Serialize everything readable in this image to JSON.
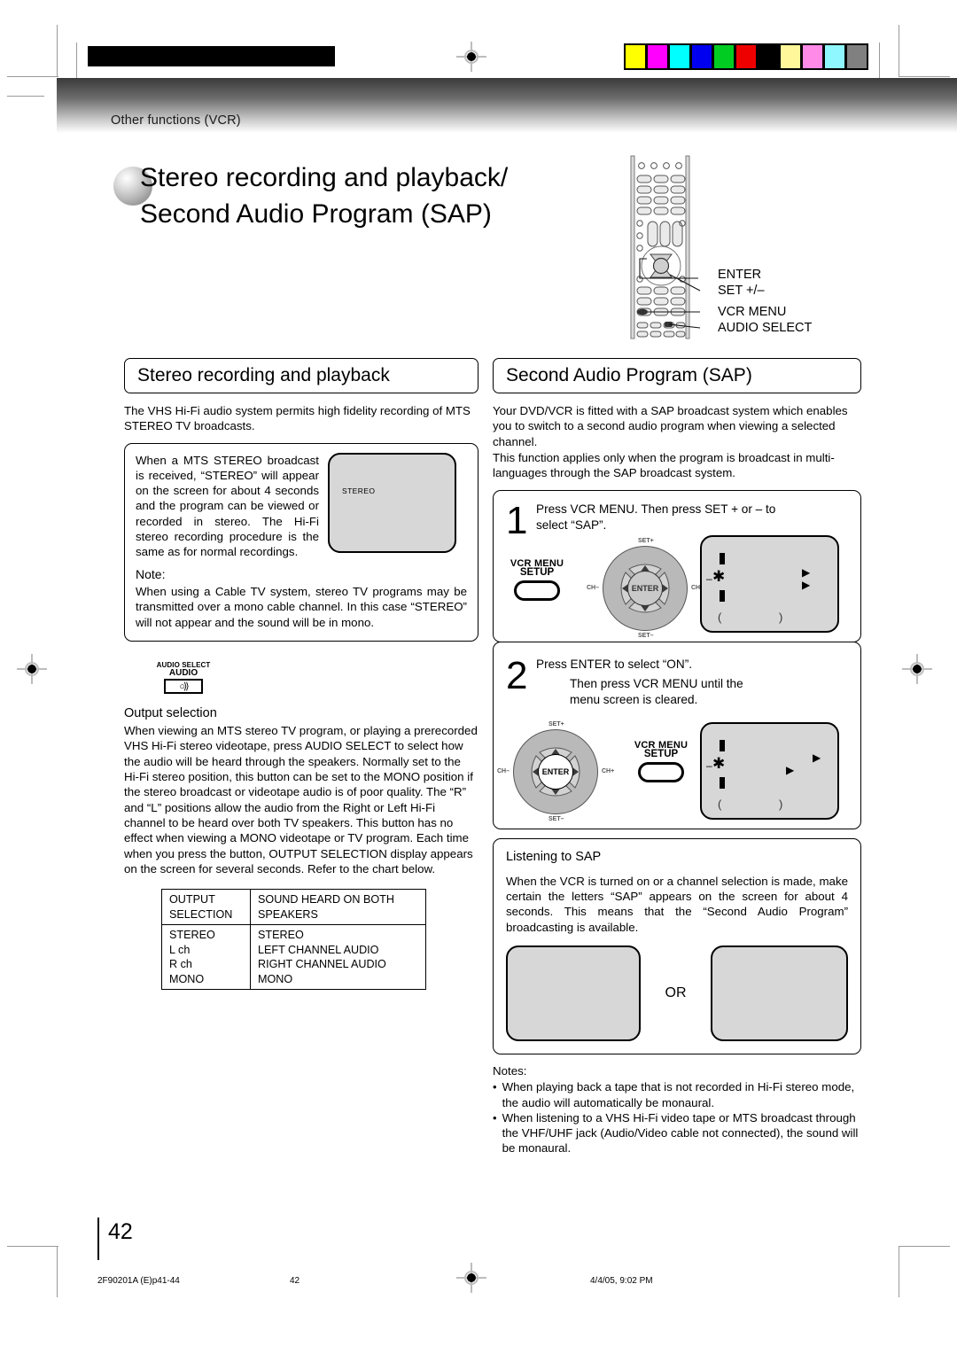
{
  "header": {
    "section_label": "Other functions (VCR)",
    "title_line1": "Stereo recording and playback/",
    "title_line2": "Second Audio Program (SAP)"
  },
  "remote_callouts": [
    {
      "label": "ENTER"
    },
    {
      "label": "SET +/–"
    },
    {
      "label": "VCR MENU"
    },
    {
      "label": "AUDIO SELECT"
    }
  ],
  "left_column": {
    "heading": "Stereo recording and playback",
    "intro": "The VHS Hi-Fi audio system permits high fidelity recording of MTS STEREO TV broadcasts.",
    "info_box": {
      "text": "When a MTS STEREO broadcast is received, “STEREO” will appear on the screen for about 4 seconds and the program can be viewed or recorded in stereo. The Hi-Fi stereo recording procedure is the same as for normal recordings.",
      "tv_label": "STEREO",
      "note_label": "Note:",
      "note_text": "When using a Cable TV system, stereo TV programs may be transmitted over a mono cable channel. In this case “STEREO” will not appear and the sound will be in mono."
    },
    "audio_button": {
      "line1": "AUDIO SELECT",
      "line2": "AUDIO",
      "glyph": "○⟩⟩"
    },
    "output_selection": {
      "heading": "Output selection",
      "text": "When viewing an MTS stereo TV program, or playing a prerecorded VHS Hi-Fi stereo videotape, press AUDIO SELECT to select how the audio will be heard through the speakers. Normally set to the Hi-Fi stereo position, this button can be set to the MONO position if the stereo broadcast or videotape audio is of poor quality. The “R” and “L” positions allow the audio from the Right or Left Hi-Fi channel to be heard over both TV speakers. This button has no effect when viewing a MONO videotape or TV program. Each time when you press the button, OUTPUT SELECTION display appears on the screen for several seconds. Refer to the chart below."
    },
    "table": {
      "headers": [
        "OUTPUT SELECTION",
        "SOUND HEARD ON BOTH SPEAKERS"
      ],
      "header_col1_line1": "OUTPUT",
      "header_col1_line2": "SELECTION",
      "header_col2_line1": "SOUND HEARD ON BOTH",
      "header_col2_line2": "SPEAKERS",
      "rows": [
        {
          "selection": "STEREO",
          "sound": "STEREO"
        },
        {
          "selection": "L ch",
          "sound": "LEFT CHANNEL AUDIO"
        },
        {
          "selection": "R ch",
          "sound": "RIGHT CHANNEL AUDIO"
        },
        {
          "selection": "MONO",
          "sound": "MONO"
        }
      ]
    }
  },
  "right_column": {
    "heading": "Second Audio Program (SAP)",
    "intro_p1": "Your DVD/VCR is fitted with a SAP broadcast system which enables you to switch to a second audio program when viewing a selected channel.",
    "intro_p2": "This function applies only when the program is broadcast in multi-languages through the SAP broadcast system.",
    "steps": [
      {
        "number": "1",
        "text_line1": "Press VCR MENU. Then press SET + or – to",
        "text_line2": "select “SAP”.",
        "menu_button": {
          "line1": "VCR MENU",
          "line2": "SETUP"
        },
        "dpad": {
          "enter": "ENTER",
          "up_label": "SET+",
          "down_label": "SET–",
          "left_label": "CH–",
          "right_label": "CH+",
          "highlight": "none"
        },
        "osd": {
          "left_paren": "(",
          "right_paren": ")",
          "dash": "–"
        }
      },
      {
        "number": "2",
        "text_line1": "Press ENTER to select “ON”.",
        "text_line2": "Then press VCR MENU until the",
        "text_line3": "menu screen is cleared.",
        "menu_button": {
          "line1": "VCR MENU",
          "line2": "SETUP"
        },
        "dpad": {
          "enter": "ENTER",
          "up_label": "SET+",
          "down_label": "SET–",
          "left_label": "CH–",
          "right_label": "CH+",
          "highlight": "enter"
        },
        "osd": {
          "left_paren": "(",
          "right_paren": ")",
          "dash": "–"
        }
      }
    ],
    "listening": {
      "heading": "Listening to SAP",
      "text": "When the VCR is turned on or a channel selection is made, make certain the letters “SAP” appears on the screen for about 4 seconds. This means that the “Second Audio Program” broadcasting is available.",
      "or_label": "OR"
    },
    "notes": {
      "label": "Notes:",
      "items": [
        "When playing back a tape that is not recorded in Hi-Fi stereo mode, the audio will automatically be monaural.",
        "When listening to a VHS Hi-Fi video tape or MTS broadcast through the VHF/UHF jack (Audio/Video cable not connected), the sound will be monaural."
      ]
    }
  },
  "footer": {
    "page_number": "42",
    "file_id": "2F90201A (E)p41-44",
    "page_mark": "42",
    "timestamp": "4/4/05, 9:02 PM"
  },
  "colors": {
    "color_bar": [
      "#ffff00",
      "#ff00ff",
      "#00ffff",
      "#0000f0",
      "#00cc22",
      "#ee0000",
      "#000000",
      "#fff799",
      "#ff8ae8",
      "#8ff7ff",
      "#808080"
    ],
    "screen_gray": "#d7d7d7",
    "band_dark": "#3a3a3a"
  }
}
